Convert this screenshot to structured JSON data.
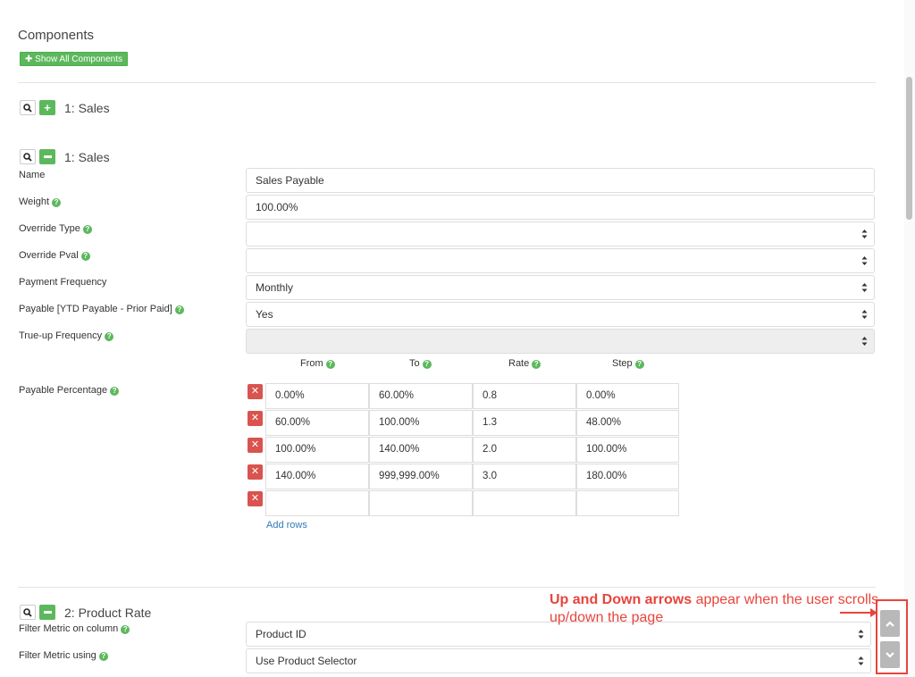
{
  "header": {
    "title": "Components",
    "show_all_label": "Show All Components"
  },
  "component_collapsed": {
    "label": "1: Sales"
  },
  "component_expanded": {
    "label": "1: Sales"
  },
  "form": {
    "name": {
      "label": "Name",
      "value": "Sales Payable"
    },
    "weight": {
      "label": "Weight",
      "value": "100.00%"
    },
    "override_type": {
      "label": "Override Type",
      "value": ""
    },
    "override_pval": {
      "label": "Override Pval",
      "value": ""
    },
    "payment_frequency": {
      "label": "Payment Frequency",
      "value": "Monthly"
    },
    "payable": {
      "label": "Payable [YTD Payable - Prior Paid]",
      "value": "Yes"
    },
    "trueup": {
      "label": "True-up Frequency",
      "value": ""
    },
    "payable_percentage": {
      "label": "Payable Percentage"
    }
  },
  "table": {
    "headers": {
      "from": "From",
      "to": "To",
      "rate": "Rate",
      "step": "Step"
    },
    "rows": [
      [
        "0.00%",
        "60.00%",
        "0.8",
        "0.00%"
      ],
      [
        "60.00%",
        "100.00%",
        "1.3",
        "48.00%"
      ],
      [
        "100.00%",
        "140.00%",
        "2.0",
        "100.00%"
      ],
      [
        "140.00%",
        "999,999.00%",
        "3.0",
        "180.00%"
      ],
      [
        "",
        "",
        "",
        ""
      ]
    ],
    "add_rows_label": "Add rows"
  },
  "component2": {
    "label": "2: Product Rate",
    "filter_column": {
      "label": "Filter Metric on column",
      "value": "Product ID"
    },
    "filter_using": {
      "label": "Filter Metric using",
      "value": "Use Product Selector"
    }
  },
  "annotation": {
    "bold": "Up and Down arrows",
    "rest": " appear when the user scrolls up/down the page"
  },
  "colors": {
    "green": "#5cb85c",
    "red": "#d9534f",
    "annotation": "#e8453c"
  },
  "icons": {
    "search": "search-icon",
    "plus": "plus-icon",
    "minus": "minus-icon",
    "help": "help-icon",
    "delete": "delete-icon",
    "up": "chevron-up-icon",
    "down": "chevron-down-icon"
  }
}
